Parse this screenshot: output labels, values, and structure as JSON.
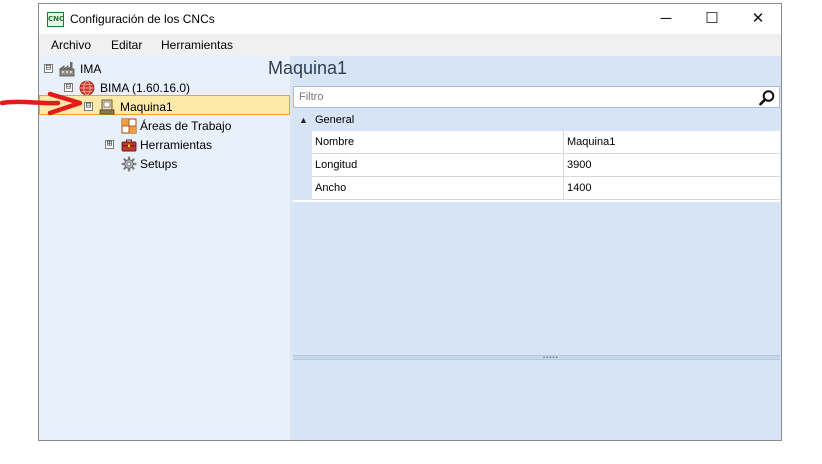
{
  "window": {
    "app_icon_text": "CNC",
    "title": "Configuración de los CNCs",
    "controls": {
      "minimize": "─",
      "maximize": "☐",
      "close": "✕"
    }
  },
  "menu": {
    "items": [
      "Archivo",
      "Editar",
      "Herramientas"
    ]
  },
  "tree": {
    "root": {
      "label": "IMA",
      "expander": "⊟",
      "icon": "factory-icon"
    },
    "controller": {
      "label": "BIMA (1.60.16.0)",
      "expander": "⊟",
      "icon": "globe-icon"
    },
    "machine": {
      "label": "Maquina1",
      "expander": "⊟",
      "icon": "machine-icon",
      "selected": true
    },
    "children": [
      {
        "label": "Áreas de Trabajo",
        "icon": "work-area-icon",
        "expander": ""
      },
      {
        "label": "Herramientas",
        "icon": "toolbox-icon",
        "expander": "⊞"
      },
      {
        "label": "Setups",
        "icon": "gear-icon",
        "expander": ""
      }
    ]
  },
  "panel": {
    "title": "Maquina1",
    "filter_placeholder": "Filtro",
    "category": {
      "label": "General",
      "toggle": "▲"
    },
    "properties": [
      {
        "name": "Nombre",
        "value": "Maquina1"
      },
      {
        "name": "Longitud",
        "value": "3900"
      },
      {
        "name": "Ancho",
        "value": "1400"
      }
    ]
  },
  "annotation": {
    "arrow_color": "#e21b1b"
  },
  "colors": {
    "selection_bg": "#fde9a8",
    "selection_border": "#e8a33a",
    "pane_bg": "#d6e4f6",
    "tree_bg": "#e8f0fa"
  }
}
